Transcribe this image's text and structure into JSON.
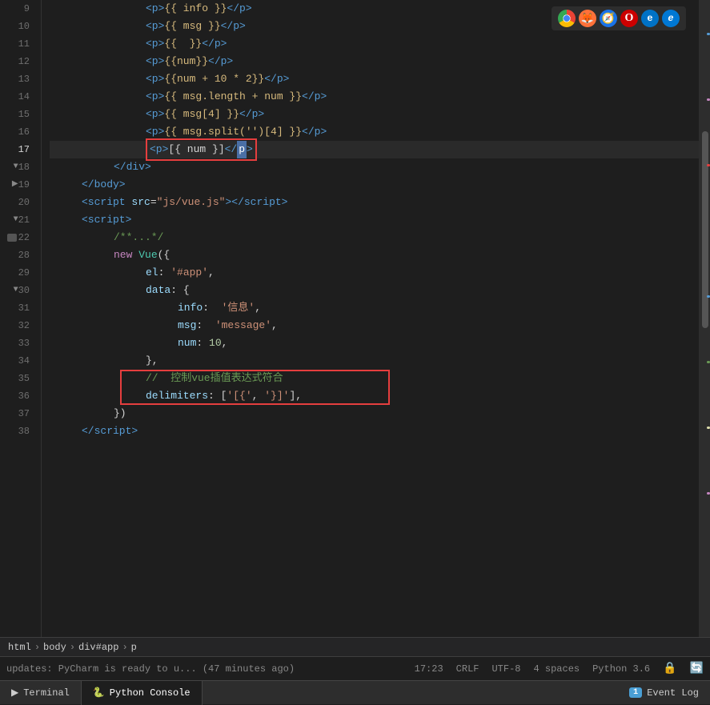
{
  "browser_icons": [
    "🌐",
    "🦊",
    "🧭",
    "⭕",
    "🌐",
    "🔵"
  ],
  "browser_colors": [
    "#ea4335",
    "#ff6611",
    "#1a73e8",
    "#cc0000",
    "#0072c6",
    "#1a73e8"
  ],
  "lines": [
    {
      "num": 9,
      "indent": 3,
      "content": "&lt;p&gt;{{ info }}&lt;/p&gt;",
      "type": "html"
    },
    {
      "num": 10,
      "indent": 3,
      "content": "&lt;p&gt;{{ msg }}&lt;/p&gt;",
      "type": "html"
    },
    {
      "num": 11,
      "indent": 3,
      "content": "&lt;p&gt;{{  }}&lt;/p&gt;",
      "type": "html"
    },
    {
      "num": 12,
      "indent": 3,
      "content": "&lt;p&gt;{{num}}&lt;/p&gt;",
      "type": "html"
    },
    {
      "num": 13,
      "indent": 3,
      "content": "&lt;p&gt;{{num + 10 * 2}}&lt;/p&gt;",
      "type": "html"
    },
    {
      "num": 14,
      "indent": 3,
      "content": "&lt;p&gt;{{ msg.length + num }}&lt;/p&gt;",
      "type": "html"
    },
    {
      "num": 15,
      "indent": 3,
      "content": "&lt;p&gt;{{ msg[4] }}&lt;/p&gt;",
      "type": "html"
    },
    {
      "num": 16,
      "indent": 3,
      "content": "&lt;p&gt;{{ msg.split('')[4] }}&lt;/p&gt;",
      "type": "html"
    },
    {
      "num": 17,
      "indent": 3,
      "content": "&lt;p&gt;[{ num }]&lt;/p&gt;",
      "type": "html_active"
    },
    {
      "num": 18,
      "indent": 2,
      "content": "&lt;/div&gt;",
      "type": "html"
    },
    {
      "num": 19,
      "indent": 1,
      "content": "&lt;/body&gt;",
      "type": "html"
    },
    {
      "num": 20,
      "indent": 1,
      "content": "&lt;script src=\"js/vue.js\"&gt;&lt;/script&gt;",
      "type": "html"
    },
    {
      "num": 21,
      "indent": 1,
      "content": "&lt;script&gt;",
      "type": "html"
    },
    {
      "num": 22,
      "indent": 2,
      "content": "/**...*/",
      "type": "comment"
    },
    {
      "num": 28,
      "indent": 2,
      "content": "new Vue({",
      "type": "js"
    },
    {
      "num": 29,
      "indent": 3,
      "content": "el: '#app',",
      "type": "js"
    },
    {
      "num": 30,
      "indent": 3,
      "content": "data: {",
      "type": "js"
    },
    {
      "num": 31,
      "indent": 4,
      "content": "info:  '信息',",
      "type": "js"
    },
    {
      "num": 32,
      "indent": 4,
      "content": "msg:  'message',",
      "type": "js"
    },
    {
      "num": 33,
      "indent": 4,
      "content": "num: 10,",
      "type": "js"
    },
    {
      "num": 34,
      "indent": 3,
      "content": "},",
      "type": "js"
    },
    {
      "num": 35,
      "indent": 3,
      "content": "//  控制vue插值表达式符合",
      "type": "comment"
    },
    {
      "num": 36,
      "indent": 3,
      "content": "delimiters: ['[{', '}]'],",
      "type": "js"
    },
    {
      "num": 37,
      "indent": 2,
      "content": "})",
      "type": "js"
    },
    {
      "num": 38,
      "indent": 1,
      "content": "&lt;/script&gt;",
      "type": "html"
    }
  ],
  "breadcrumb": {
    "items": [
      "html",
      "body",
      "div#app",
      "p"
    ]
  },
  "status": {
    "line_col": "17:23",
    "eol": "CRLF",
    "encoding": "UTF-8",
    "indent": "4 spaces",
    "python": "Python 3.6"
  },
  "tabs": {
    "terminal": "Terminal",
    "python_console": "Python Console",
    "event_log": "Event Log",
    "event_log_count": "1"
  },
  "status_bar_text": "updates: PyCharm is ready to u... (47 minutes ago)"
}
